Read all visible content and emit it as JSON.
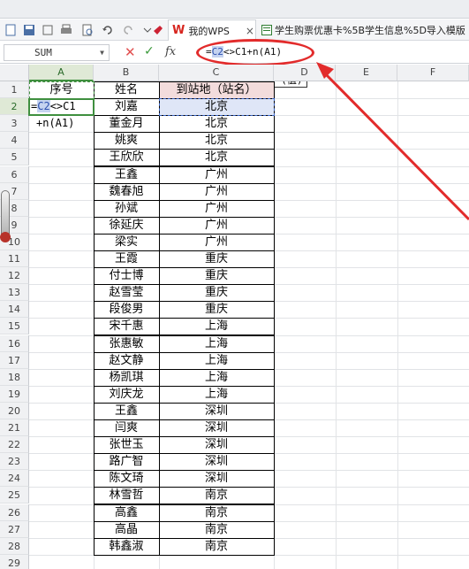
{
  "tabs": [
    {
      "label": "我的WPS",
      "close": "×"
    },
    {
      "label": "学生购票优惠卡%5B学生信息%5D导入模版"
    }
  ],
  "formula_bar": {
    "name_box": "SUM",
    "fx": "fx",
    "formula_pre": "=",
    "formula_ref": "C2",
    "formula_post": "<>C1+n(A1)"
  },
  "tooltip": "N (值)",
  "columns": [
    "A",
    "B",
    "C",
    "D",
    "E",
    "F"
  ],
  "row_numbers": [
    "1",
    "2",
    "3",
    "4",
    "5",
    "6",
    "7",
    "8",
    "9",
    "10",
    "11",
    "12",
    "13",
    "14",
    "15",
    "16",
    "17",
    "18",
    "19",
    "20",
    "21",
    "22",
    "23",
    "24",
    "25",
    "26",
    "27",
    "28",
    "29"
  ],
  "headers": {
    "A": "序号",
    "B": "姓名",
    "C": "到站地（站名）"
  },
  "cell_edit": {
    "line1_pre": "=",
    "line1_ref": "C2",
    "line1_post": "<>C1",
    "line2": "+n(A1)"
  },
  "rows": [
    {
      "name": "刘嘉",
      "station": "北京"
    },
    {
      "name": "董金月",
      "station": "北京"
    },
    {
      "name": "姚爽",
      "station": "北京"
    },
    {
      "name": "王欣欣",
      "station": "北京"
    },
    {
      "name": "王鑫",
      "station": "广州"
    },
    {
      "name": "魏春旭",
      "station": "广州"
    },
    {
      "name": "孙斌",
      "station": "广州"
    },
    {
      "name": "徐延庆",
      "station": "广州"
    },
    {
      "name": "梁实",
      "station": "广州"
    },
    {
      "name": "王霞",
      "station": "重庆"
    },
    {
      "name": "付士博",
      "station": "重庆"
    },
    {
      "name": "赵雪莹",
      "station": "重庆"
    },
    {
      "name": "段俊男",
      "station": "重庆"
    },
    {
      "name": "宋千惠",
      "station": "上海"
    },
    {
      "name": "张惠敏",
      "station": "上海"
    },
    {
      "name": "赵文静",
      "station": "上海"
    },
    {
      "name": "杨凯琪",
      "station": "上海"
    },
    {
      "name": "刘庆龙",
      "station": "上海"
    },
    {
      "name": "王鑫",
      "station": "深圳"
    },
    {
      "name": "闫爽",
      "station": "深圳"
    },
    {
      "name": "张世玉",
      "station": "深圳"
    },
    {
      "name": "路广智",
      "station": "深圳"
    },
    {
      "name": "陈文琦",
      "station": "深圳"
    },
    {
      "name": "林雪哲",
      "station": "南京"
    },
    {
      "name": "高鑫",
      "station": "南京"
    },
    {
      "name": "高晶",
      "station": "南京"
    },
    {
      "name": "韩鑫淑",
      "station": "南京"
    }
  ],
  "colors": {
    "accent_red": "#e22b2b",
    "selection_green": "#3f8f3f",
    "ref_blue": "#3a66c8",
    "header_fill": "#f3dcdc"
  }
}
